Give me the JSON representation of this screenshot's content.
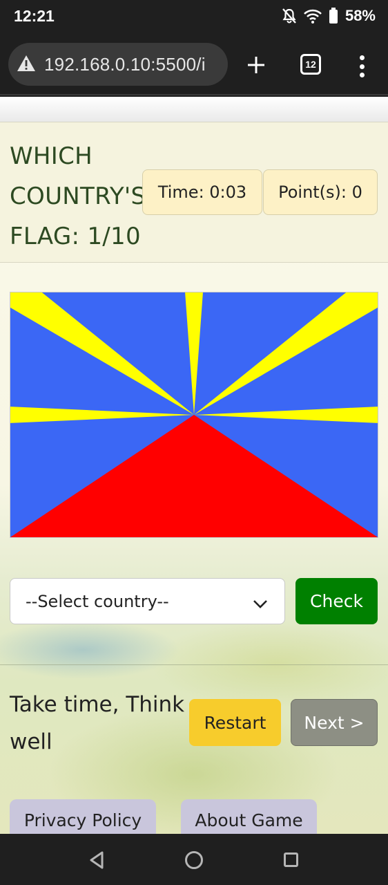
{
  "status_bar": {
    "time": "12:21",
    "battery": "58%",
    "icons": [
      "bell-off-icon",
      "wifi-icon",
      "battery-icon"
    ]
  },
  "browser": {
    "url": "192.168.0.10:5500/i",
    "tab_count": "12",
    "icons": [
      "warning-icon",
      "plus-icon",
      "tabs-icon",
      "menu-icon"
    ]
  },
  "game": {
    "title_line1": "WHICH",
    "title_line2": "COUNTRY'S",
    "title_line3": "FLAG: 1/10",
    "time_label": "Time: 0:03",
    "points_label": "Point(s): 0",
    "flag": {
      "colors": {
        "blue": "#3b67f5",
        "yellow": "#ffff00",
        "red": "#ff0000"
      }
    },
    "select_placeholder": "--Select country--",
    "check_label": "Check",
    "tip_text": "Take time, Think well",
    "restart_label": "Restart",
    "next_label": "Next >",
    "privacy_label": "Privacy Policy",
    "about_label": "About Game"
  },
  "colors": {
    "check_button": "#008000",
    "restart_button": "#f7cc2c",
    "next_button": "#8d8f84",
    "title_text": "#2d4a22",
    "header_band": "#f5f3de"
  },
  "navbar": {
    "icons": [
      "back-icon",
      "home-icon",
      "recent-apps-icon"
    ]
  }
}
